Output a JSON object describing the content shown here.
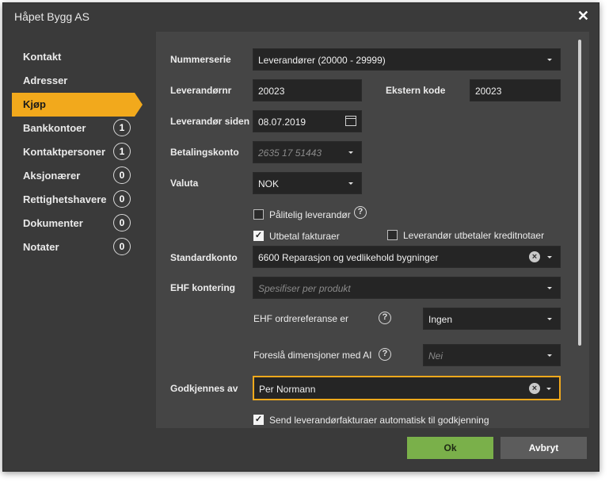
{
  "dialog": {
    "title": "Håpet Bygg AS"
  },
  "sidebar": {
    "items": [
      {
        "label": "Kontakt"
      },
      {
        "label": "Adresser"
      },
      {
        "label": "Kjøp"
      },
      {
        "label": "Bankkontoer",
        "count": "1"
      },
      {
        "label": "Kontaktpersoner",
        "count": "1"
      },
      {
        "label": "Aksjonærer",
        "count": "0"
      },
      {
        "label": "Rettighetshavere",
        "count": "0"
      },
      {
        "label": "Dokumenter",
        "count": "0"
      },
      {
        "label": "Notater",
        "count": "0"
      }
    ],
    "active_index": 2
  },
  "form": {
    "nummerserie": {
      "label": "Nummerserie",
      "value": "Leverandører (20000 - 29999)"
    },
    "leverandornr": {
      "label": "Leverandørnr",
      "value": "20023"
    },
    "ekstern_kode": {
      "label": "Ekstern kode",
      "value": "20023"
    },
    "leverandor_siden": {
      "label": "Leverandør siden",
      "value": "08.07.2019"
    },
    "betalingskonto": {
      "label": "Betalingskonto",
      "placeholder": "2635 17 51443"
    },
    "valuta": {
      "label": "Valuta",
      "value": "NOK"
    },
    "palitelig": {
      "label": "Pålitelig leverandør",
      "checked": false
    },
    "utbetal": {
      "label": "Utbetal fakturaer",
      "checked": true
    },
    "kreditnotaer": {
      "label": "Leverandør utbetaler kreditnotaer",
      "checked": false
    },
    "standardkonto": {
      "label": "Standardkonto",
      "value": "6600 Reparasjon og vedlikehold bygninger"
    },
    "ehf_kontering": {
      "label": "EHF kontering",
      "placeholder": "Spesifiser per produkt"
    },
    "ehf_ordreref": {
      "label": "EHF ordrereferanse er",
      "value": "Ingen"
    },
    "foresla_dim": {
      "label": "Foreslå dimensjoner med AI",
      "placeholder": "Nei"
    },
    "godkjennes": {
      "label": "Godkjennes av",
      "value": "Per Normann"
    },
    "send_auto": {
      "label": "Send leverandørfakturaer automatisk til godkjenning",
      "checked": true
    }
  },
  "footer": {
    "ok_label": "Ok",
    "cancel_label": "Avbryt"
  },
  "colors": {
    "accent": "#f2a91c",
    "ok": "#7ab04a",
    "cancel": "#5c5c5c"
  }
}
